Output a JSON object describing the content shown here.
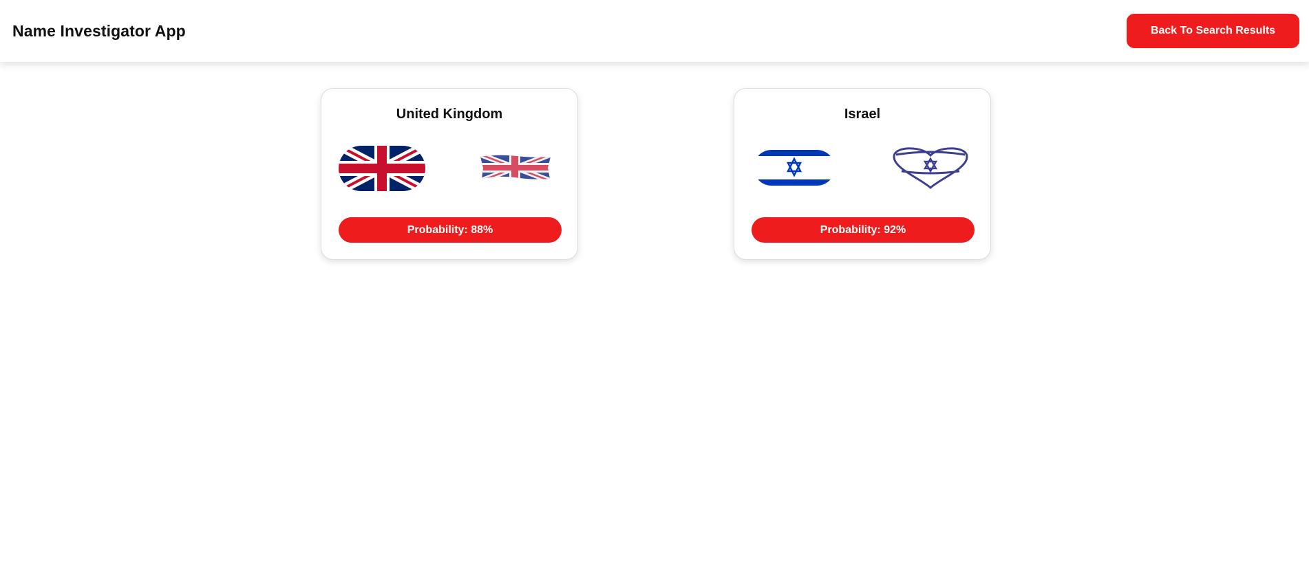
{
  "header": {
    "title": "Name Investigator App",
    "back_button_label": "Back To Search Results"
  },
  "colors": {
    "accent": "#ee1c1c",
    "uk_blue": "#012169",
    "uk_red": "#c8102e",
    "israel_blue": "#0038b8"
  },
  "results": [
    {
      "country": "United Kingdom",
      "probability_label": "Probability: 88%",
      "probability": 88,
      "flag_icons": [
        "uk-flag-pill-icon",
        "uk-flag-wavy-icon"
      ]
    },
    {
      "country": "Israel",
      "probability_label": "Probability: 92%",
      "probability": 92,
      "flag_icons": [
        "israel-flag-pill-icon",
        "israel-flag-heart-icon"
      ]
    }
  ]
}
